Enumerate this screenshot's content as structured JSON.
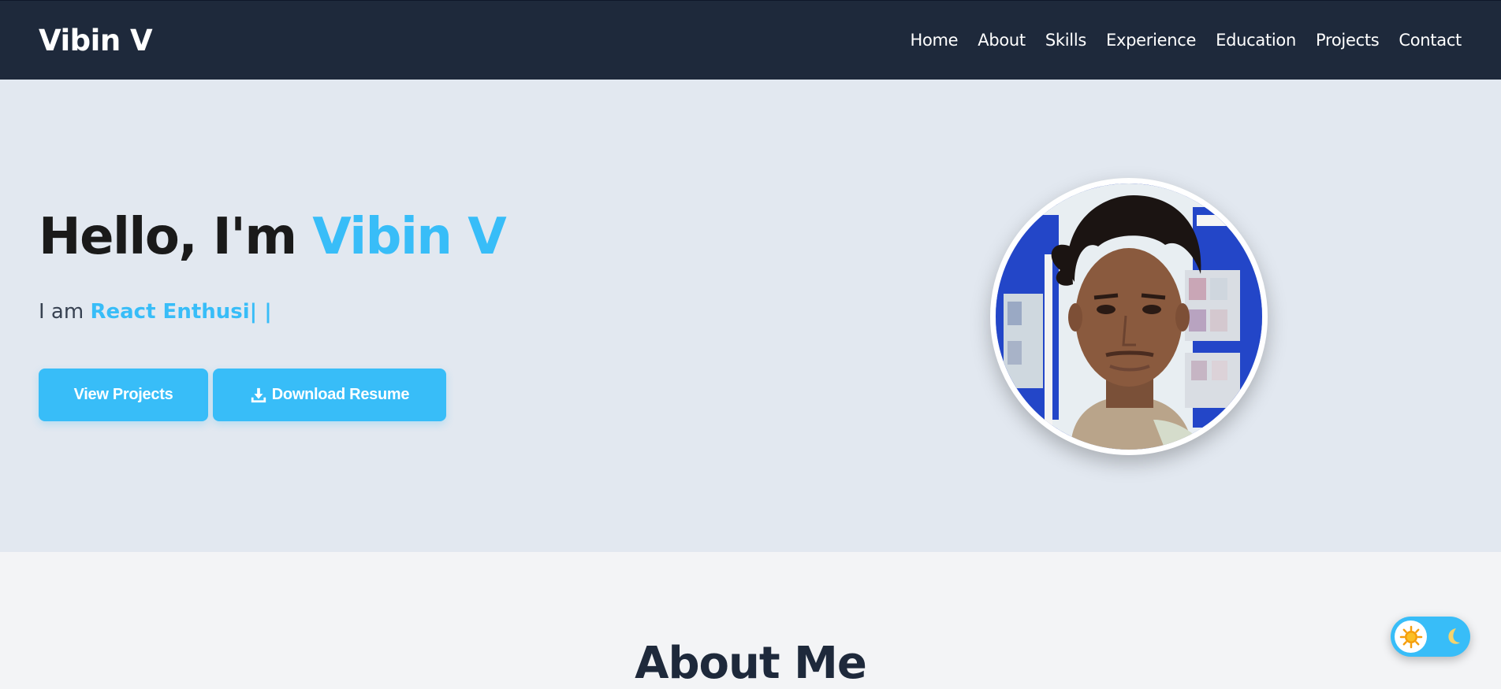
{
  "nav": {
    "brand": "Vibin V",
    "links": [
      "Home",
      "About",
      "Skills",
      "Experience",
      "Education",
      "Projects",
      "Contact"
    ]
  },
  "hero": {
    "greeting": "Hello, I'm ",
    "name": "Vibin V",
    "subtitle_prefix": "I am ",
    "typed_text": "React Enthusi| |",
    "view_projects_label": "View Projects",
    "download_resume_label": "Download Resume",
    "download_icon": "download-icon",
    "avatar_alt": "profile-photo"
  },
  "about": {
    "title": "About Me"
  },
  "theme_toggle": {
    "sun_icon": "sun-icon",
    "moon_icon": "moon-icon"
  },
  "colors": {
    "navbar": "#1e293b",
    "accent": "#38bdf8",
    "hero_bg": "#e2e8f0",
    "about_bg": "#f3f4f6"
  }
}
